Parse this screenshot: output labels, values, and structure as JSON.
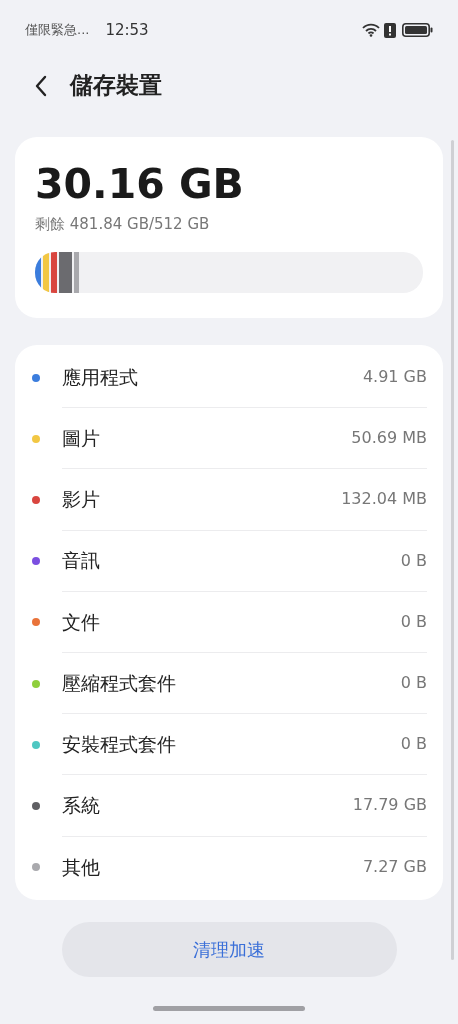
{
  "status_bar": {
    "carrier": "僅限緊急...",
    "time": "12:53"
  },
  "header": {
    "title": "儲存裝置"
  },
  "summary": {
    "used": "30.16 GB",
    "remaining": "剩餘 481.84 GB/512 GB",
    "segments": [
      {
        "color": "#3b7ddd"
      },
      {
        "color": "#f2c744"
      },
      {
        "color": "#d9463f"
      },
      {
        "color": "#6b6b6f"
      },
      {
        "color": "#a9a9ad"
      }
    ]
  },
  "categories": [
    {
      "label": "應用程式",
      "size": "4.91 GB",
      "color": "#3b7ddd"
    },
    {
      "label": "圖片",
      "size": "50.69 MB",
      "color": "#f2c744"
    },
    {
      "label": "影片",
      "size": "132.04 MB",
      "color": "#d9463f"
    },
    {
      "label": "音訊",
      "size": "0 B",
      "color": "#7b4fe0"
    },
    {
      "label": "文件",
      "size": "0 B",
      "color": "#e9733a"
    },
    {
      "label": "壓縮程式套件",
      "size": "0 B",
      "color": "#8fcf3c"
    },
    {
      "label": "安裝程式套件",
      "size": "0 B",
      "color": "#4fc7c2"
    },
    {
      "label": "系統",
      "size": "17.79 GB",
      "color": "#5f5f63"
    },
    {
      "label": "其他",
      "size": "7.27 GB",
      "color": "#a9a9ad"
    }
  ],
  "action": {
    "label": "清理加速"
  }
}
